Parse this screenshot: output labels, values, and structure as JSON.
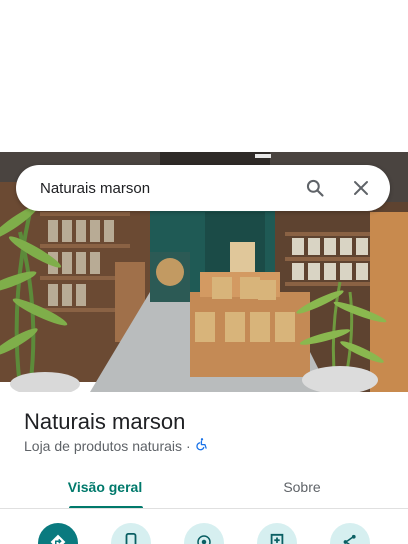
{
  "search": {
    "query": "Naturais marson"
  },
  "place": {
    "name": "Naturais marson",
    "category": "Loja de produtos naturais",
    "separator": "·",
    "accessibility_icon": "wheelchair-icon"
  },
  "tabs": [
    {
      "label": "Visão geral",
      "selected": true
    },
    {
      "label": "Sobre",
      "selected": false
    }
  ],
  "actions": [
    {
      "icon": "directions-icon"
    },
    {
      "icon": "phone-icon"
    },
    {
      "icon": "location-icon"
    },
    {
      "icon": "save-icon"
    },
    {
      "icon": "share-icon"
    }
  ],
  "colors": {
    "accent": "#00796b",
    "primary_action": "#0a7a7f",
    "secondary_action": "#d6eff0",
    "accessibility": "#1a73e8"
  }
}
